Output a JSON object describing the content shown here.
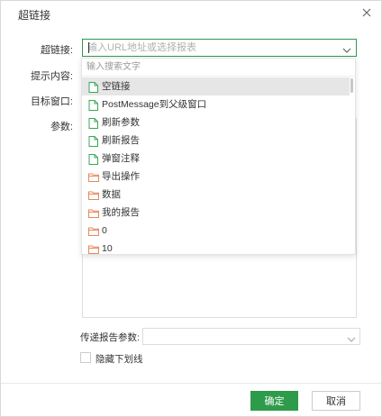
{
  "dialog": {
    "title": "超链接",
    "close_icon": "close-icon"
  },
  "form": {
    "hyperlink_label": "超链接:",
    "hint_label": "提示内容:",
    "target_label": "目标窗口:",
    "params_label": "参数:",
    "url_placeholder": "输入URL地址或选择报表",
    "pass_params_label": "传递报告参数:",
    "pass_params_value": "",
    "hide_underline_label": "隐藏下划线",
    "hide_underline_checked": false
  },
  "dropdown": {
    "search_placeholder": "输入搜索文字",
    "items": [
      {
        "label": "空链接",
        "icon": "file-icon",
        "selected": true
      },
      {
        "label": "PostMessage到父级窗口",
        "icon": "file-icon",
        "selected": false
      },
      {
        "label": "刷新参数",
        "icon": "file-icon",
        "selected": false
      },
      {
        "label": "刷新报告",
        "icon": "file-icon",
        "selected": false
      },
      {
        "label": "弹窗注释",
        "icon": "file-icon",
        "selected": false
      },
      {
        "label": "导出操作",
        "icon": "folder-icon",
        "selected": false
      },
      {
        "label": "数据",
        "icon": "folder-icon",
        "selected": false
      },
      {
        "label": "我的报告",
        "icon": "folder-icon",
        "selected": false
      },
      {
        "label": "0",
        "icon": "folder-icon",
        "selected": false
      },
      {
        "label": "10",
        "icon": "folder-icon",
        "selected": false
      }
    ]
  },
  "footer": {
    "ok_label": "确定",
    "cancel_label": "取消"
  },
  "colors": {
    "accent": "#2e9b4a",
    "file_icon": "#3aa655",
    "folder_icon": "#e8875a",
    "selected_row": "#e6e6e6"
  }
}
